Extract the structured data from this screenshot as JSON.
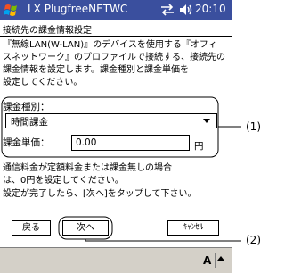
{
  "titlebar": {
    "app_name": "LX PlugfreeNETWC",
    "time": "20:10",
    "start_icon": "windows-flag-icon",
    "connectivity_icon": "connectivity-icon",
    "volume_icon": "speaker-icon",
    "color": "#3a4f9e"
  },
  "screen_title": "接続先の課金情報設定",
  "description": [
    "『無線LAN(W-LAN)』のデバイスを使用する『オフィ",
    "スネットワーク』のプロファイルで接続する、接続先の",
    "課金情報を設定します。課金種別と課金単価を",
    "設定してください。"
  ],
  "billing_type": {
    "label": "課金種別：",
    "selected": "時間課金"
  },
  "billing_price": {
    "label": "課金単価：",
    "value": "0.00",
    "unit": "円"
  },
  "note": [
    "通信料金が定額料金または課金無しの場合",
    "は、0円を設定してください。"
  ],
  "instruction": "設定が完了したら、[次へ]をタップして下さい。",
  "buttons": {
    "back": "戻る",
    "next": "次へ",
    "cancel": "ｷｬﾝｾﾙ"
  },
  "bottombar": {
    "sip_label": "A"
  },
  "callouts": {
    "one": "(1)",
    "two": "(2)"
  }
}
